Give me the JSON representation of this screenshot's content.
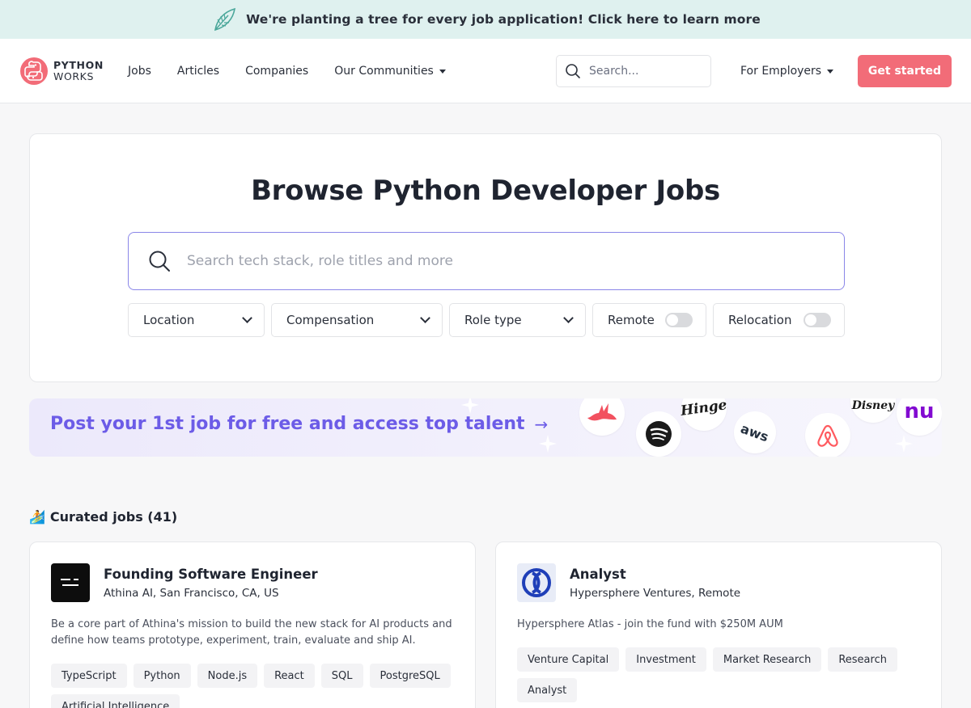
{
  "banner": {
    "text": "We're planting a tree for every job application! Click here to learn more",
    "icon": "leaf-icon"
  },
  "header": {
    "logo": {
      "line1": "PYTHON",
      "line2": "WORKS"
    },
    "nav": [
      {
        "label": "Jobs"
      },
      {
        "label": "Articles"
      },
      {
        "label": "Companies"
      },
      {
        "label": "Our Communities",
        "dropdown": true
      }
    ],
    "search_placeholder": "Search...",
    "employers_label": "For Employers",
    "cta_label": "Get started",
    "cta_color": "#f26c78"
  },
  "hero": {
    "title": "Browse Python Developer Jobs",
    "search_placeholder": "Search tech stack, role titles and more",
    "filters": {
      "location": "Location",
      "compensation": "Compensation",
      "role_type": "Role type",
      "remote": "Remote",
      "relocation": "Relocation"
    }
  },
  "promo": {
    "text": "Post your 1st job for free and access top talent",
    "arrow": "→",
    "accent": "#6c5ce7",
    "logos": [
      "rabbit-logo",
      "spotify-logo",
      "hinge-logo",
      "aws-logo",
      "airbnb-logo",
      "disney-logo",
      "nu-logo"
    ],
    "hinge_text": "Hinge",
    "aws_text": "aws",
    "disney_text": "Disney",
    "nu_text": "nu"
  },
  "curated": {
    "emoji": "🏄",
    "title": "Curated jobs (41)"
  },
  "jobs": [
    {
      "title": "Founding Software Engineer",
      "company": "Athina AI, San Francisco, CA, US",
      "description": "Be a core part of Athina's mission to build the new stack for AI products and define how teams prototype, experiment, train, evaluate and ship AI.",
      "tags": [
        "TypeScript",
        "Python",
        "Node.js",
        "React",
        "SQL",
        "PostgreSQL",
        "Artificial Intelligence"
      ]
    },
    {
      "title": "Analyst",
      "company": "Hypersphere Ventures, Remote",
      "description": "Hypersphere Atlas - join the fund with $250M AUM",
      "tags": [
        "Venture Capital",
        "Investment",
        "Market Research",
        "Research",
        "Analyst"
      ]
    }
  ]
}
